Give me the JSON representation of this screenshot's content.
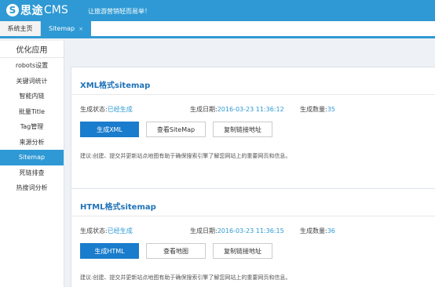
{
  "header": {
    "logo_mark": "S",
    "logo_name": "思途",
    "logo_suffix": "CMS",
    "slogan": "让旅游营销轻而易举！"
  },
  "tabs": [
    {
      "label": "系统主页"
    },
    {
      "label": "Sitemap",
      "close": "×"
    }
  ],
  "sidebar": {
    "title": "优化应用",
    "items": [
      {
        "label": "robots设置"
      },
      {
        "label": "关键词统计"
      },
      {
        "label": "智能内链"
      },
      {
        "label": "批量Title"
      },
      {
        "label": "Tag管理"
      },
      {
        "label": "来源分析"
      },
      {
        "label": "Sitemap"
      },
      {
        "label": "死链排查"
      },
      {
        "label": "热搜词分析"
      }
    ]
  },
  "xml": {
    "title": "XML格式sitemap",
    "status_label": "生成状态:",
    "status_value": "已经生成",
    "date_label": "生成日期:",
    "date_value": "2016-03-23 11:36:12",
    "count_label": "生成数量:",
    "count_value": "35",
    "btn_generate": "生成XML",
    "btn_view": "查看SiteMap",
    "btn_copy": "复制链接地址",
    "tip": "建议:创建、提交并更新站点地图有助于确保搜索引擎了解您网站上的重要网页和信息。"
  },
  "html": {
    "title": "HTML格式sitemap",
    "status_label": "生成状态:",
    "status_value": "已经生成",
    "date_label": "生成日期:",
    "date_value": "2016-03-23 11:36:15",
    "count_label": "生成数量:",
    "count_value": "36",
    "btn_generate": "生成HTML",
    "btn_view": "查看地图",
    "btn_copy": "复制链接地址",
    "tip": "建议:创建、提交并更新站点地图有助于确保搜索引擎了解您网站上的重要网页和信息。"
  },
  "colors": {
    "brand": "#2e99d4",
    "primary_button": "#1a7ccc",
    "title_blue": "#1f72b8"
  }
}
